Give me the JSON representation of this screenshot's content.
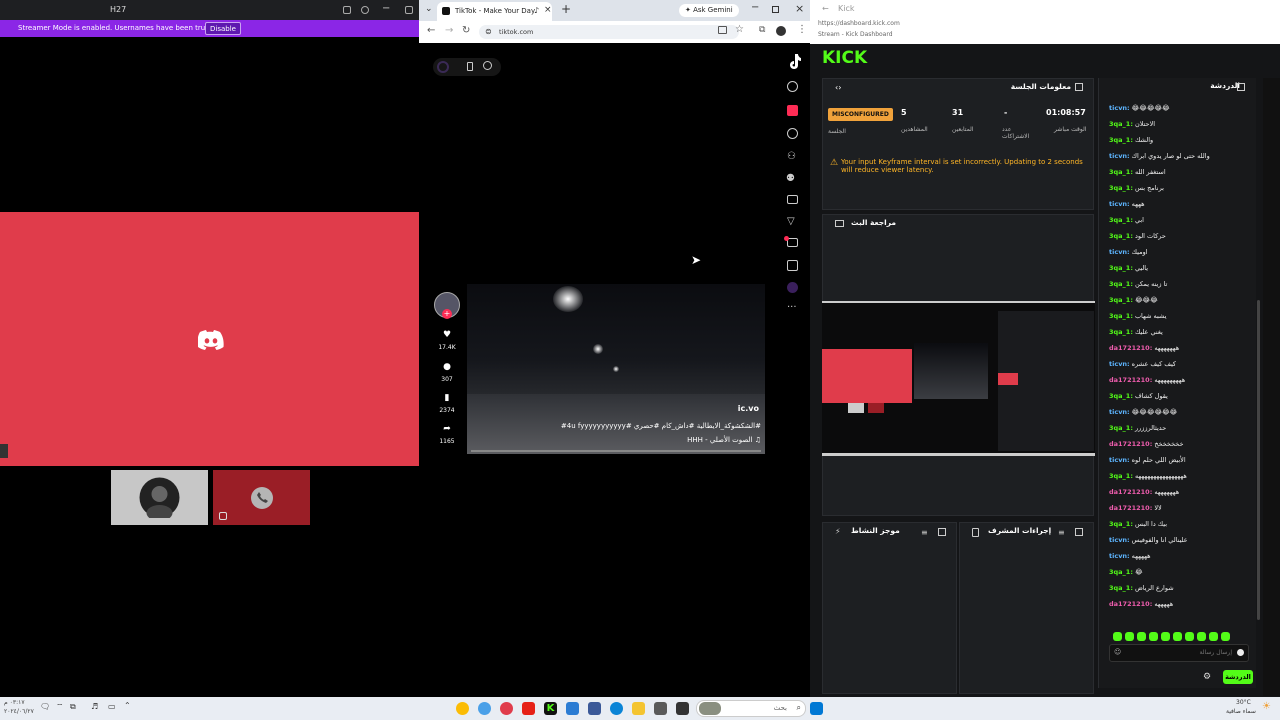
{
  "discord": {
    "title": "H27",
    "streamer_msg": "Streamer Mode is enabled. Usernames have been truncated.",
    "disable_label": "Disable",
    "colors": {
      "stage": "#e03c4b",
      "banner": "#8b26e6"
    }
  },
  "browser": {
    "tab_title": "TikTok - Make Your Day",
    "gemini_label": "Ask Gemini",
    "url": "tiktok.com",
    "video": {
      "watermark": "ic.vo",
      "caption": "#الشكشوكة_الايطالية #داش_كام #حصري #4u fyyyyyyyyyyy#",
      "sound": "HHH - الصوت الأصلي"
    },
    "actions": {
      "likes": "17.4K",
      "comments": "307",
      "saves": "2374",
      "shares": "1165"
    }
  },
  "kick": {
    "address": "https://dashboard.kick.com",
    "page_title": "Stream - Kick Dashboard",
    "logo": "KICK",
    "session_panel_title": "معلومات الجلسة",
    "stats": [
      {
        "value": "MISCONFIGURED",
        "label": "الجلسة"
      },
      {
        "value": "5",
        "label": "المشاهدين"
      },
      {
        "value": "31",
        "label": "المتابعين"
      },
      {
        "value": "-",
        "label": "عدد الاشتراكات"
      },
      {
        "value": "01:08:57",
        "label": "الوقت مباشر"
      }
    ],
    "warning": "Your input Keyframe interval is set incorrectly. Updating to 2 seconds will reduce viewer latency.",
    "preview_title": "مراجعة البث",
    "activity_title": "موجز النشاط",
    "mod_title": "إجراءات المشرف",
    "chat_title": "الدردشة",
    "chat_placeholder": "إرسال رسالة",
    "send_label": "الدردشة",
    "chat": [
      {
        "user": "ticvn:",
        "msg": "😂😂😂😂😂",
        "c": "b"
      },
      {
        "user": "3qa_1:",
        "msg": "الاحتلان",
        "c": "g"
      },
      {
        "user": "3qa_1:",
        "msg": "والشك",
        "c": "g"
      },
      {
        "user": "ticvn:",
        "msg": "والله حتى لو صار يدوي ابراك",
        "c": "b"
      },
      {
        "user": "3qa_1:",
        "msg": "استغفر الله",
        "c": "g"
      },
      {
        "user": "3qa_1:",
        "msg": "برنامج بس",
        "c": "g"
      },
      {
        "user": "ticvn:",
        "msg": "هههه",
        "c": "b"
      },
      {
        "user": "3qa_1:",
        "msg": "ابي",
        "c": "g"
      },
      {
        "user": "3qa_1:",
        "msg": "حركات الود",
        "c": "g"
      },
      {
        "user": "ticvn:",
        "msg": "اوميك",
        "c": "b"
      },
      {
        "user": "3qa_1:",
        "msg": "ياليي",
        "c": "g"
      },
      {
        "user": "3qa_1:",
        "msg": "تا زينه يمكن",
        "c": "g"
      },
      {
        "user": "3qa_1:",
        "msg": "😂😂😂",
        "c": "g"
      },
      {
        "user": "3qa_1:",
        "msg": "يشبه شهاب",
        "c": "g"
      },
      {
        "user": "3qa_1:",
        "msg": "يغني عليك",
        "c": "g"
      },
      {
        "user": "da1721210:",
        "msg": "هههههههه",
        "c": "p"
      },
      {
        "user": "ticvn:",
        "msg": "كيف كيف عشره",
        "c": "b"
      },
      {
        "user": "da1721210:",
        "msg": "هههههههههه",
        "c": "p"
      },
      {
        "user": "3qa_1:",
        "msg": "يقول كشاف",
        "c": "g"
      },
      {
        "user": "ticvn:",
        "msg": "😂😂😂😂😂😂",
        "c": "b"
      },
      {
        "user": "3qa_1:",
        "msg": "حديثالرززرر",
        "c": "g"
      },
      {
        "user": "da1721210:",
        "msg": "خخخخخخخ",
        "c": "p"
      },
      {
        "user": "ticvn:",
        "msg": "الأبيض اللي حلم لوه",
        "c": "b"
      },
      {
        "user": "3qa_1:",
        "msg": "ههههههههههههههههه",
        "c": "g"
      },
      {
        "user": "da1721210:",
        "msg": "هههههههه",
        "c": "p"
      },
      {
        "user": "da1721210:",
        "msg": "لالا",
        "c": "p"
      },
      {
        "user": "3qa_1:",
        "msg": "بيك دا البس",
        "c": "g"
      },
      {
        "user": "ticvn:",
        "msg": "علينالي انا والفوفيس",
        "c": "b"
      },
      {
        "user": "ticvn:",
        "msg": "هههههه",
        "c": "b"
      },
      {
        "user": "3qa_1:",
        "msg": "😂",
        "c": "g"
      },
      {
        "user": "3qa_1:",
        "msg": "شوارع الرياض",
        "c": "g"
      },
      {
        "user": "da1721210:",
        "msg": "هههههه",
        "c": "p"
      }
    ]
  },
  "taskbar": {
    "search_placeholder": "بحث",
    "weather": "سماء صافية",
    "temp": "30°C",
    "date": "٢٠٢٤/٠٦/٢٧",
    "time": "٠٣:١٧ م"
  }
}
